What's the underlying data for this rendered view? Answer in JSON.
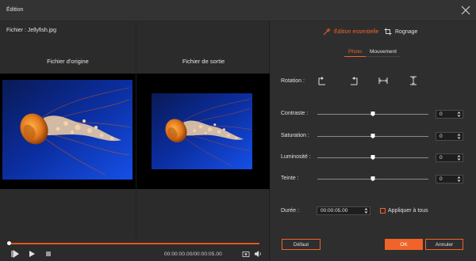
{
  "window": {
    "title": "Édition"
  },
  "file": {
    "label": "Fichier : Jellyfish.jpg"
  },
  "preview": {
    "original_title": "Fichier d'origine",
    "output_title": "Fichier de sortie"
  },
  "playback": {
    "timecode": "00:00:00.00/00:00:05.00",
    "progress": 0.0
  },
  "tabs": {
    "essential": "Édition essentielle",
    "crop": "Rognage"
  },
  "subtabs": {
    "photo": "Photo",
    "movement": "Mouvement"
  },
  "rotation": {
    "label": "Rotation :"
  },
  "adjustments": [
    {
      "key": "contrast",
      "label": "Contraste :",
      "value": "0",
      "level": 0.5
    },
    {
      "key": "saturation",
      "label": "Saturation :",
      "value": "0",
      "level": 0.5
    },
    {
      "key": "brightness",
      "label": "Luminosité :",
      "value": "0",
      "level": 0.5
    },
    {
      "key": "hue",
      "label": "Teinte :",
      "value": "0",
      "level": 0.5
    }
  ],
  "duration": {
    "label": "Durée :",
    "value": "00:00:05.00"
  },
  "apply_all": {
    "label": "Appliquer à tous",
    "checked": false
  },
  "buttons": {
    "default": "Défaut",
    "ok": "OK",
    "cancel": "Annuler"
  },
  "colors": {
    "accent": "#f0632a",
    "background": "#2b2b2b",
    "panel": "#2e2e2e"
  }
}
